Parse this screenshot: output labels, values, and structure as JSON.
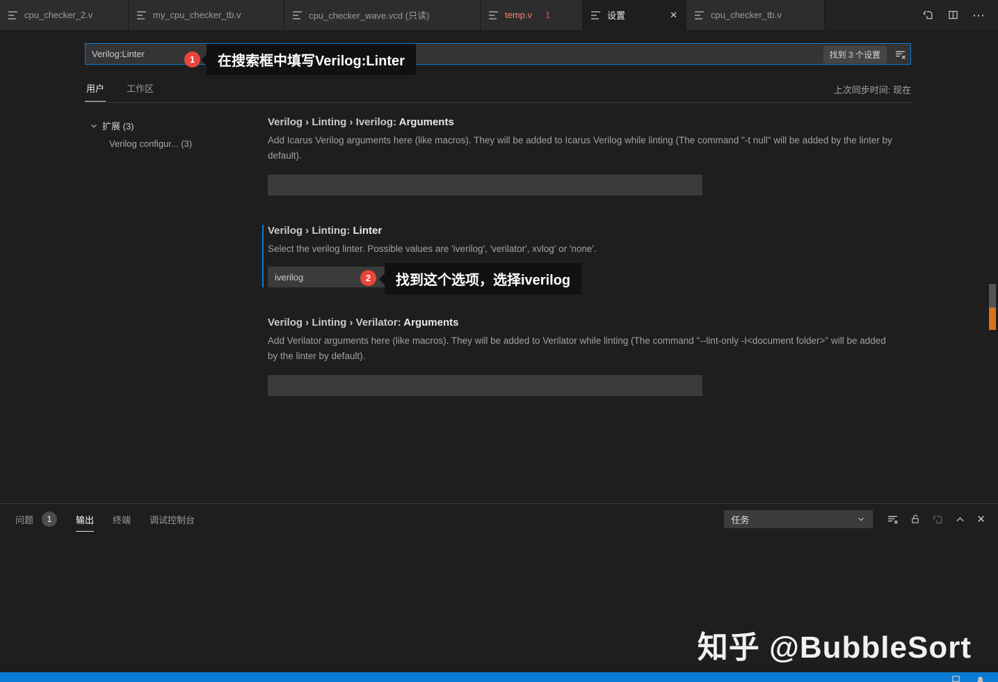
{
  "tab_bar": {
    "tabs": [
      {
        "label": "cpu_checker_2.v"
      },
      {
        "label": "my_cpu_checker_tb.v"
      },
      {
        "label": "cpu_checker_wave.vcd (只读)"
      },
      {
        "label": "temp.v",
        "badge": "1"
      },
      {
        "label": "设置"
      },
      {
        "label": "cpu_checker_tb.v"
      }
    ]
  },
  "icons": {
    "more": "⋯",
    "close": "✕"
  },
  "settings_editor": {
    "search": {
      "value": "Verilog:Linter",
      "result_count": "找到 3 个设置"
    },
    "scope": {
      "user": "用户",
      "workspace": "工作区",
      "sync": "上次同步时间: 现在"
    },
    "toc": {
      "group": "扩展 (3)",
      "item": "Verilog configur... (3)"
    },
    "items": [
      {
        "category": "Verilog › Linting › Iverilog: ",
        "label": "Arguments",
        "description": "Add Icarus Verilog arguments here (like macros). They will be added to Icarus Verilog while linting (The command \"-t null\" will be added by the linter by default).",
        "value": ""
      },
      {
        "category": "Verilog › Linting: ",
        "label": "Linter",
        "description": "Select the verilog linter. Possible values are 'iverilog', 'verilator', xvlog' or 'none'.",
        "value": "iverilog"
      },
      {
        "category": "Verilog › Linting › Verilator: ",
        "label": "Arguments",
        "description": "Add Verilator arguments here (like macros). They will be added to Verilator while linting (The command \"--lint-only -I<document folder>\" will be added by the linter by default).",
        "value": ""
      }
    ]
  },
  "annotations": [
    {
      "number": "1",
      "text": "在搜索框中填写Verilog:Linter"
    },
    {
      "number": "2",
      "text": "找到这个选项，选择iverilog"
    }
  ],
  "panel": {
    "tabs": [
      {
        "label": "问题",
        "badge": "1"
      },
      {
        "label": "输出"
      },
      {
        "label": "终端"
      },
      {
        "label": "调试控制台"
      }
    ],
    "channel_select": "任务"
  },
  "watermark": "知乎 @BubbleSort",
  "colors": {
    "statusbar": "#0a7cd6",
    "badge_red": "#e8463a",
    "modified_bar": "#0c7ad8",
    "focus_border": "#0f7cd6",
    "overview_match": "#d8741a"
  }
}
